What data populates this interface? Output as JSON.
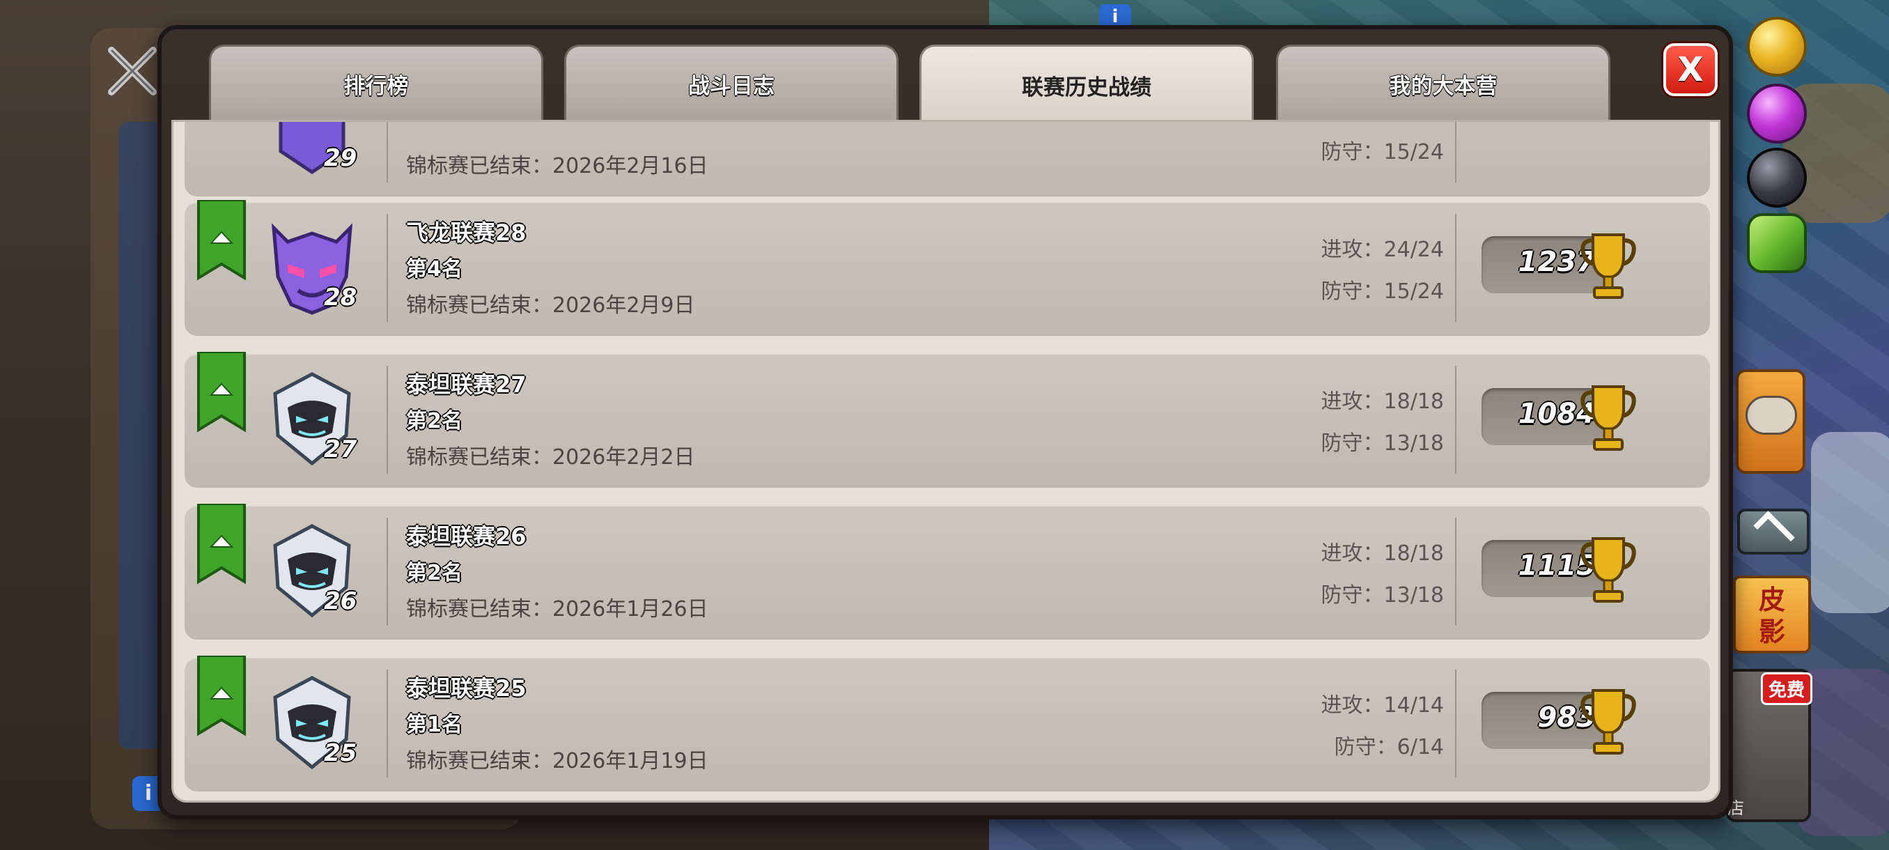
{
  "tabs": [
    {
      "label": "排行榜",
      "active": false
    },
    {
      "label": "战斗日志",
      "active": false
    },
    {
      "label": "联赛历史战绩",
      "active": true
    },
    {
      "label": "我的大本营",
      "active": false
    }
  ],
  "close_label": "X",
  "attack_prefix": "进攻：",
  "defense_prefix": "防守：",
  "rows": [
    {
      "league": "",
      "badge_level": "29",
      "rank": "",
      "ended": "锦标赛已结束：2026年2月16日",
      "attack": "",
      "defense": "防守：15/24",
      "trophies": "",
      "badge_color": "#7a5ad6",
      "partial": true
    },
    {
      "league": "飞龙联赛28",
      "badge_level": "28",
      "rank": "第4名",
      "ended": "锦标赛已结束：2026年2月9日",
      "attack": "进攻：24/24",
      "defense": "防守：15/24",
      "trophies": "1237",
      "badge_color": "#7a5ad6"
    },
    {
      "league": "泰坦联赛27",
      "badge_level": "27",
      "rank": "第2名",
      "ended": "锦标赛已结束：2026年2月2日",
      "attack": "进攻：18/18",
      "defense": "防守：13/18",
      "trophies": "1084",
      "badge_color": "#dfe6ee"
    },
    {
      "league": "泰坦联赛26",
      "badge_level": "26",
      "rank": "第2名",
      "ended": "锦标赛已结束：2026年1月26日",
      "attack": "进攻：18/18",
      "defense": "防守：13/18",
      "trophies": "1115",
      "badge_color": "#dfe6ee"
    },
    {
      "league": "泰坦联赛25",
      "badge_level": "25",
      "rank": "第1名",
      "ended": "锦标赛已结束：2026年1月19日",
      "attack": "进攻：14/14",
      "defense": "防守：6/14",
      "trophies": "983",
      "badge_color": "#dfe6ee"
    }
  ],
  "hud": {
    "pi_label": "皮\n影",
    "free_label": "免费",
    "shop_label": "店",
    "info_label": "i"
  },
  "colors": {
    "ribbon_green": "#3fa52a",
    "trophy_gold": "#e8b41c",
    "close_red": "#e03020",
    "active_tab": "#ece7df"
  }
}
